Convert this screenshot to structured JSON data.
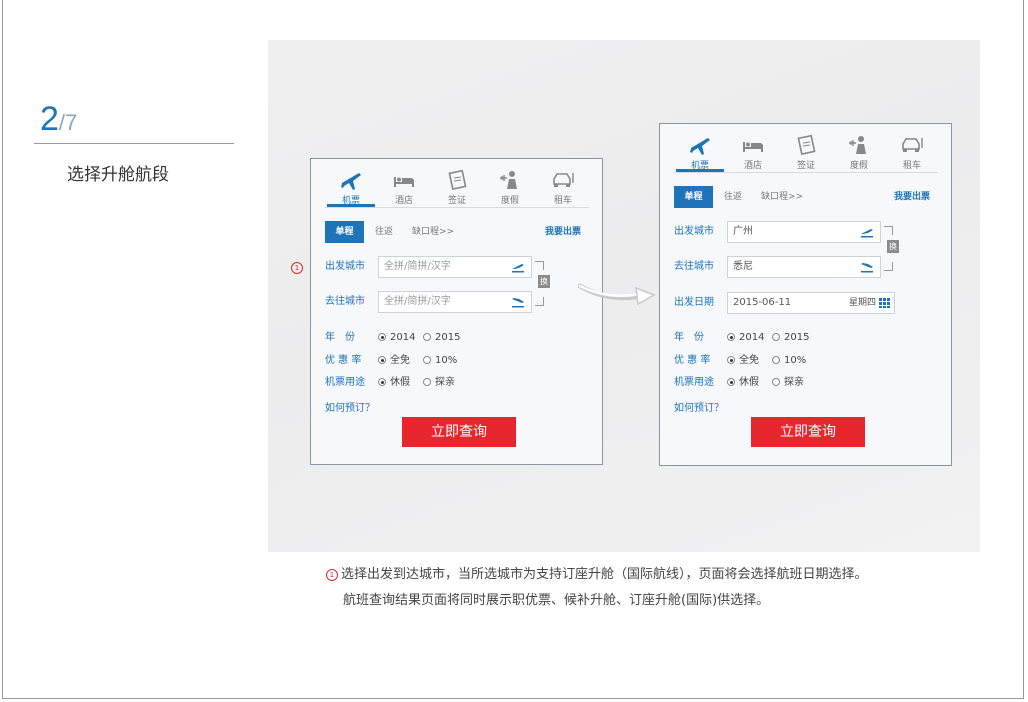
{
  "step": {
    "current": "2",
    "total": "/7",
    "title": "选择升舱航段"
  },
  "tabs": [
    {
      "label": "机票",
      "icon": "airplane-icon"
    },
    {
      "label": "酒店",
      "icon": "bed-icon"
    },
    {
      "label": "签证",
      "icon": "visa-icon"
    },
    {
      "label": "度假",
      "icon": "vacation-icon"
    },
    {
      "label": "租车",
      "icon": "car-icon"
    }
  ],
  "trip": {
    "oneway": "单程",
    "roundtrip": "往返",
    "multicity": "缺口程>>",
    "mine": "我要出票"
  },
  "form": {
    "depart_label": "出发城市",
    "arrive_label": "去往城市",
    "date_label": "出发日期",
    "city_placeholder": "全拼/简拼/汉字",
    "swap_label": "换"
  },
  "options": {
    "year_label": "年　份",
    "year_a": "2014",
    "year_b": "2015",
    "discount_label": "优 惠 率",
    "discount_a": "全免",
    "discount_b": "10%",
    "purpose_label": "机票用途",
    "purpose_a": "休假",
    "purpose_b": "探亲"
  },
  "how_to": "如何预订？",
  "search_label": "立即查询",
  "panel2": {
    "depart_city": "广州",
    "arrive_city": "悉尼",
    "date": "2015-06-11",
    "weekday": "星期四"
  },
  "marker": "1",
  "caption": {
    "line1": "选择出发到达城市，当所选城市为支持订座升舱（国际航线），页面将会选择航班日期选择。",
    "line2": "航班查询结果页面将同时展示职优票、候补升舱、订座升舱(国际)供选择。"
  },
  "colors": {
    "accent": "#1d74b8",
    "search": "#e7262e",
    "marker": "#d92b2b"
  }
}
